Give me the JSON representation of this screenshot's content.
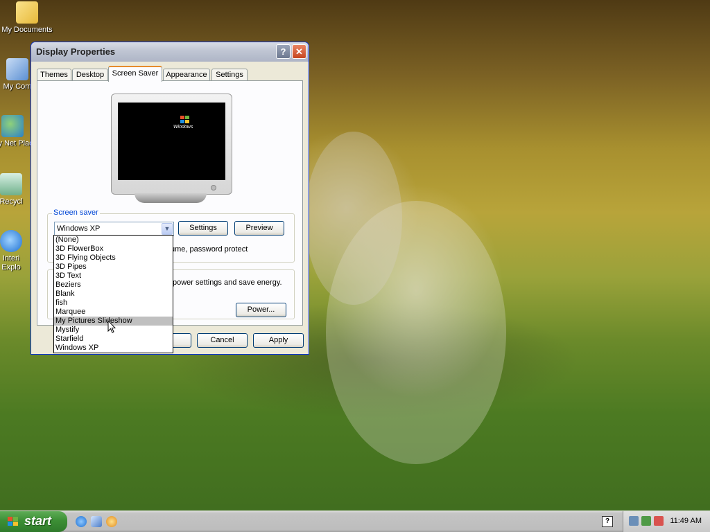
{
  "desktop": {
    "icons": [
      {
        "label": "My Documents",
        "icon": "folder-documents-icon"
      },
      {
        "label": "My Com",
        "icon": "my-computer-icon"
      },
      {
        "label": "My Net Plac",
        "icon": "network-places-icon"
      },
      {
        "label": "Recycl",
        "icon": "recycle-bin-icon"
      },
      {
        "label": "Interi Explo",
        "icon": "internet-explorer-icon"
      }
    ]
  },
  "window": {
    "title": "Display Properties",
    "help_button": "?",
    "close_button": "✕",
    "tabs": [
      {
        "label": "Themes",
        "active": false
      },
      {
        "label": "Desktop",
        "active": false
      },
      {
        "label": "Screen Saver",
        "active": true
      },
      {
        "label": "Appearance",
        "active": false
      },
      {
        "label": "Settings",
        "active": false
      }
    ],
    "preview_logo_text": "Windows",
    "screen_saver": {
      "group_label": "Screen saver",
      "selected": "Windows XP",
      "settings_button": "Settings",
      "preview_button": "Preview",
      "resume_text": "ume, password protect",
      "options": [
        "(None)",
        "3D FlowerBox",
        "3D Flying Objects",
        "3D Pipes",
        "3D Text",
        "Beziers",
        "Blank",
        "fish",
        "Marquee",
        "My Pictures Slideshow",
        "Mystify",
        "Starfield",
        "Windows XP"
      ],
      "hovered_index": 9
    },
    "monitor_power": {
      "text": "power settings and save energy.",
      "power_button": "Power..."
    },
    "buttons": {
      "ok": "",
      "cancel": "Cancel",
      "apply": "Apply"
    }
  },
  "taskbar": {
    "start_label": "start",
    "clock": "11:49 AM",
    "colors": {
      "start": "#3c8f35",
      "title_active": "#0831d9"
    }
  }
}
